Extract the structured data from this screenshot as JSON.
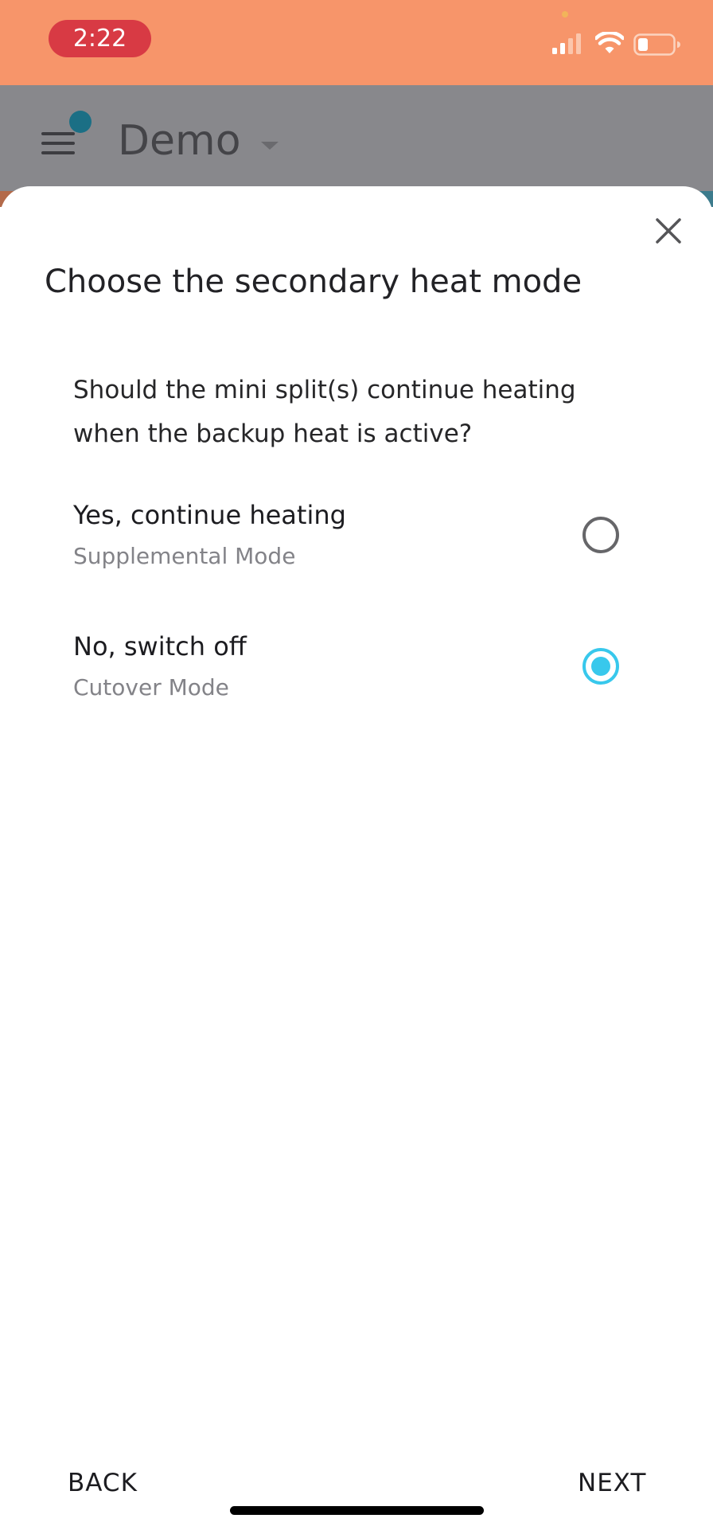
{
  "status_bar": {
    "time": "2:22",
    "color": "#f7956a",
    "time_pill_color": "#d83a44",
    "icons": [
      "signal-icon",
      "wifi-icon",
      "battery-icon"
    ]
  },
  "app_header": {
    "title": "Demo",
    "icons": [
      "menu-icon",
      "caret-down-icon"
    ]
  },
  "sheet": {
    "title": "Choose the secondary heat mode",
    "question": "Should the mini split(s) continue heating when the backup heat is active?",
    "close_icon": "close-icon",
    "options": [
      {
        "label": "Yes, continue heating",
        "sublabel": "Supplemental Mode",
        "selected": false
      },
      {
        "label": "No, switch off",
        "sublabel": "Cutover Mode",
        "selected": true
      }
    ],
    "accent_color": "#38c8ec"
  },
  "footer": {
    "back_label": "BACK",
    "next_label": "NEXT"
  }
}
